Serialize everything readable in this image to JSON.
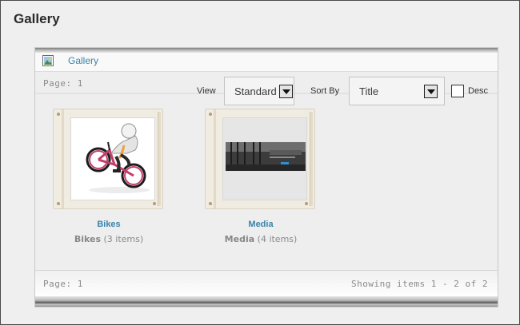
{
  "page": {
    "title": "Gallery"
  },
  "panel": {
    "header_title": "Gallery",
    "header_icon": "image-icon",
    "page_top": "Page: 1",
    "page_bottom": "Page: 1",
    "showing": "Showing items 1 - 2 of 2"
  },
  "toolbar": {
    "view_label": "View",
    "view_value": "Standard",
    "sort_label": "Sort By",
    "sort_value": "Title",
    "desc_label": "Desc",
    "desc_checked": false
  },
  "albums": [
    {
      "name": "Bikes",
      "count_name": "Bikes",
      "count_text": "(3 items)",
      "thumb": "bmx-rider-photo"
    },
    {
      "name": "Media",
      "count_name": "Media",
      "count_text": "(4 items)",
      "thumb": "forest-banner-photo"
    }
  ],
  "colors": {
    "link": "#3a84aa",
    "background": "#efefef",
    "muted": "#8a8a8a"
  }
}
